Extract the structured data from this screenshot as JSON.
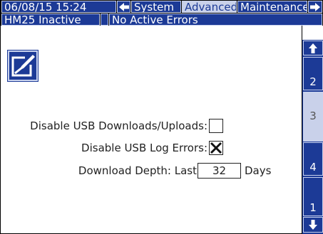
{
  "header": {
    "datetime": "06/08/15 15:24",
    "tabs": [
      {
        "label": "System",
        "active": false
      },
      {
        "label": "Advanced",
        "active": true
      },
      {
        "label": "Maintenance",
        "active": false
      }
    ],
    "left_arrow_icon": "arrow-left-icon",
    "right_arrow_icon": "arrow-right-icon"
  },
  "status": {
    "device": "HM25 Inactive",
    "errors": "No Active Errors"
  },
  "colors": {
    "accent": "#1c3a96",
    "active_tab": "#c9d1ea",
    "background": "#ffffff"
  },
  "main": {
    "edit_icon": "edit-pencil-icon",
    "disable_usb_label": "Disable USB Downloads/Uploads:",
    "disable_usb_checked": false,
    "disable_log_errors_label": "Disable USB Log Errors:",
    "disable_log_errors_checked": true,
    "download_depth_label": "Download Depth: Last",
    "download_depth_value": "32",
    "download_depth_unit": "Days"
  },
  "side_nav": {
    "up_icon": "arrow-up-icon",
    "pages": [
      {
        "label": "2",
        "active": false
      },
      {
        "label": "3",
        "active": true
      },
      {
        "label": "4",
        "active": false
      },
      {
        "label": "1",
        "active": false
      }
    ],
    "down_icon": "arrow-down-icon"
  }
}
